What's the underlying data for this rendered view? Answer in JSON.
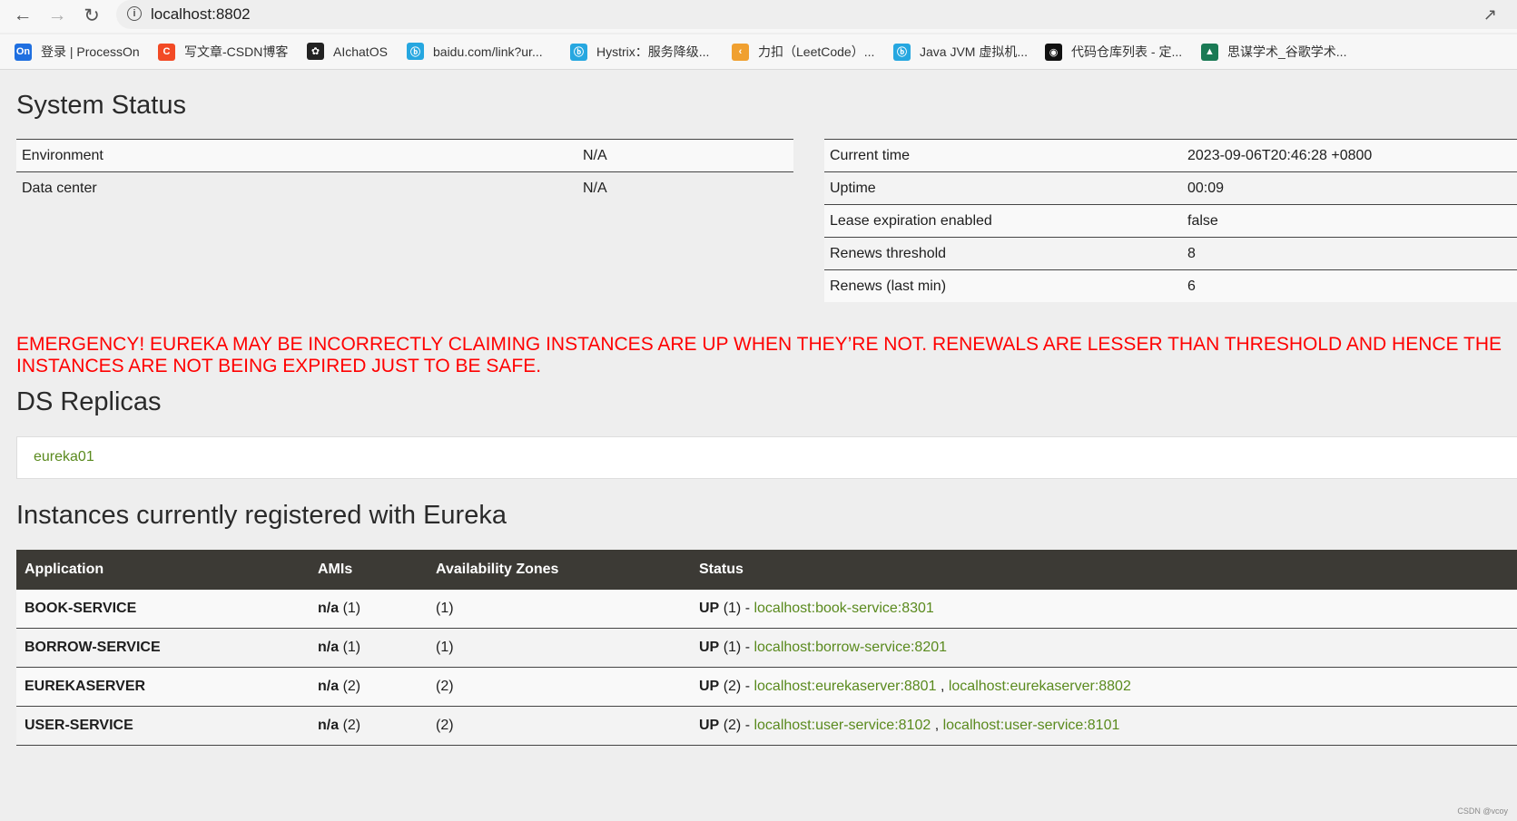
{
  "browser": {
    "url": "localhost:8802",
    "bookmarks": [
      {
        "label": "登录 | ProcessOn",
        "icon": "processon-icon",
        "glyph": "On",
        "color": "#1f6fe0"
      },
      {
        "label": "写文章-CSDN博客",
        "icon": "csdn-icon",
        "glyph": "C",
        "color": "#f24a25"
      },
      {
        "label": "AIchatOS",
        "icon": "openai-icon",
        "glyph": "✿",
        "color": "#222222"
      },
      {
        "label": "baidu.com/link?ur...",
        "icon": "bilibili-icon",
        "glyph": "ⓑ",
        "color": "#26a7e0"
      },
      {
        "label": "Hystrix：服务降级...",
        "icon": "bilibili-icon",
        "glyph": "ⓑ",
        "color": "#26a7e0"
      },
      {
        "label": "力扣（LeetCode）...",
        "icon": "leetcode-icon",
        "glyph": "‹",
        "color": "#f0a030"
      },
      {
        "label": "Java JVM 虚拟机...",
        "icon": "bilibili-icon",
        "glyph": "ⓑ",
        "color": "#26a7e0"
      },
      {
        "label": "代码仓库列表 - 定...",
        "icon": "eye-icon",
        "glyph": "◉",
        "color": "#111111"
      },
      {
        "label": "思谋学术_谷歌学术...",
        "icon": "scholar-icon",
        "glyph": "▲",
        "color": "#1a7a55"
      }
    ]
  },
  "system_status": {
    "title": "System Status",
    "left": [
      {
        "label": "Environment",
        "value": "N/A"
      },
      {
        "label": "Data center",
        "value": "N/A"
      }
    ],
    "right": [
      {
        "label": "Current time",
        "value": "2023-09-06T20:46:28 +0800"
      },
      {
        "label": "Uptime",
        "value": "00:09"
      },
      {
        "label": "Lease expiration enabled",
        "value": "false"
      },
      {
        "label": "Renews threshold",
        "value": "8"
      },
      {
        "label": "Renews (last min)",
        "value": "6"
      }
    ]
  },
  "emergency": {
    "line1": "EMERGENCY! EUREKA MAY BE INCORRECTLY CLAIMING INSTANCES ARE UP WHEN THEY’RE NOT. RENEWALS ARE LESSER THAN THRESHOLD AND HENCE THE",
    "line2": "INSTANCES ARE NOT BEING EXPIRED JUST TO BE SAFE."
  },
  "replicas": {
    "title": "DS Replicas",
    "items": [
      "eureka01"
    ]
  },
  "instances": {
    "title": "Instances currently registered with Eureka",
    "headers": [
      "Application",
      "AMIs",
      "Availability Zones",
      "Status"
    ],
    "rows": [
      {
        "app": "BOOK-SERVICE",
        "amis_label": "n/a",
        "amis_count": "(1)",
        "zones": "(1)",
        "status": "UP",
        "status_count": "(1) -",
        "links": [
          "localhost:book-service:8301"
        ]
      },
      {
        "app": "BORROW-SERVICE",
        "amis_label": "n/a",
        "amis_count": "(1)",
        "zones": "(1)",
        "status": "UP",
        "status_count": "(1) -",
        "links": [
          "localhost:borrow-service:8201"
        ]
      },
      {
        "app": "EUREKASERVER",
        "amis_label": "n/a",
        "amis_count": "(2)",
        "zones": "(2)",
        "status": "UP",
        "status_count": "(2) -",
        "links": [
          "localhost:eurekaserver:8801",
          "localhost:eurekaserver:8802"
        ]
      },
      {
        "app": "USER-SERVICE",
        "amis_label": "n/a",
        "amis_count": "(2)",
        "zones": "(2)",
        "status": "UP",
        "status_count": "(2) -",
        "links": [
          "localhost:user-service:8102",
          "localhost:user-service:8101"
        ]
      }
    ],
    "link_separator": ","
  },
  "watermark": "CSDN @vcoy",
  "colors": {
    "link": "#5a8a1e",
    "emergency": "#ff0000",
    "table_header": "#3c3a35"
  }
}
